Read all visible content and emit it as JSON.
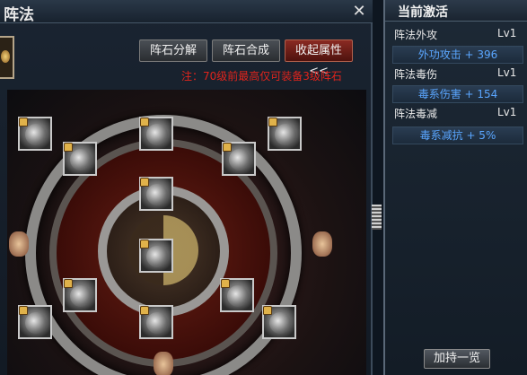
{
  "window": {
    "title": "阵法",
    "close_icon": "close-icon"
  },
  "toolbar": {
    "decompose_label": "阵石分解",
    "compose_label": "阵石合成",
    "collapse_label": "收起属性<<"
  },
  "notice": "注：70级前最高仅可装备3级阵石",
  "board": {
    "slot_count": 12,
    "lock_icon": "lock-icon",
    "stone_icon": "formation-stone-icon"
  },
  "current_active": {
    "title": "当前激活",
    "stats": [
      {
        "name": "阵法外攻",
        "level": "Lv1",
        "effect": "外功攻击 + 396"
      },
      {
        "name": "阵法毒伤",
        "level": "Lv1",
        "effect": "毒系伤害 + 154"
      },
      {
        "name": "阵法毒减",
        "level": "Lv1",
        "effect": "毒系减抗 + 5%"
      }
    ],
    "overview_label": "加持一览"
  },
  "colors": {
    "accent_blue": "#5aa6ff",
    "notice_red": "#e0241c",
    "collapse_red": "#8a2a22"
  }
}
